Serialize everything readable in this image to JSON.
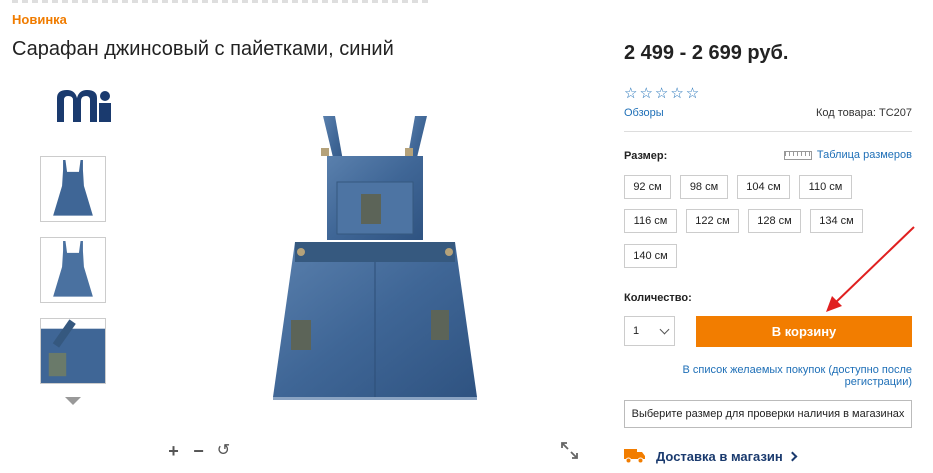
{
  "badge": "Новинка",
  "product": {
    "title": "Сарафан джинсовый с пайетками, синий",
    "price": "2 499 - 2 699 руб.",
    "rating_stars": "☆☆☆☆☆",
    "reviews_label": "Обзоры",
    "sku_label": "Код товара: TC207"
  },
  "sizes": {
    "label": "Размер:",
    "table_link": "Таблица размеров",
    "options": [
      "92 см",
      "98 см",
      "104 см",
      "110 см",
      "116 см",
      "122 см",
      "128 см",
      "134 см",
      "140 см"
    ]
  },
  "quantity": {
    "label": "Количество:",
    "value": "1"
  },
  "actions": {
    "add_to_cart": "В корзину",
    "wishlist": "В список желаемых покупок (доступно после регистрации)",
    "check_stores": "Выберите размер для проверки наличия в магазинах",
    "delivery": "Доставка в магазин"
  },
  "gallery": {
    "zoom_in": "+",
    "zoom_out": "−",
    "reset": "↺"
  },
  "colors": {
    "accent": "#f27d00",
    "link": "#1e6fb7",
    "brand_navy": "#1a3a6e",
    "denim": "#3f6696",
    "annotation_arrow": "#e02020"
  }
}
